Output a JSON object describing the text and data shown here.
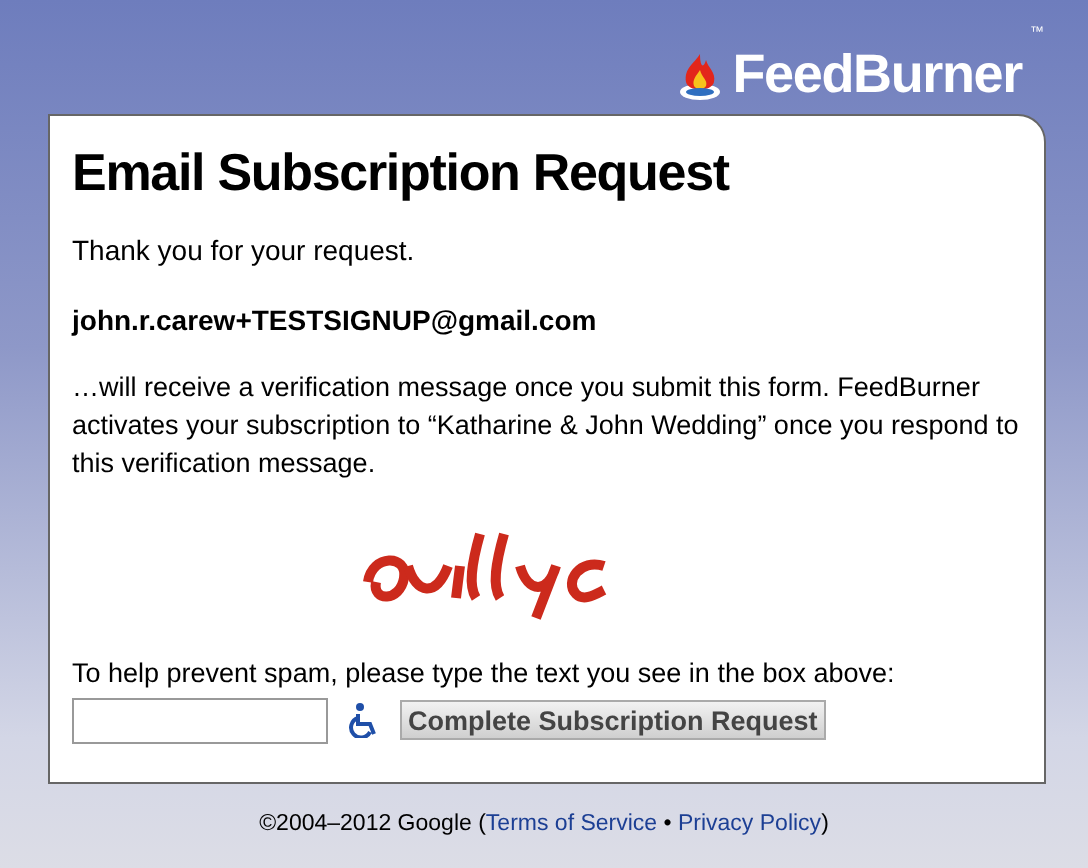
{
  "header": {
    "logo_text": "FeedBurner",
    "logo_mark": "™"
  },
  "card": {
    "title": "Email Subscription Request",
    "thanks": "Thank you for your request.",
    "email": "john.r.carew+TESTSIGNUP@gmail.com",
    "message": "…will receive a verification message once you submit this form. FeedBurner activates your subscription to “Katharine & John Wedding” once you respond to this verification message.",
    "prompt": "To help prevent spam, please type the text you see in the box above:",
    "submit_button": "Complete Subscription Request"
  },
  "footer": {
    "copyright": "©2004–2012 Google (",
    "links": [
      "Terms of Service",
      "Privacy Policy"
    ],
    "separator": " • ",
    "close": ")"
  }
}
